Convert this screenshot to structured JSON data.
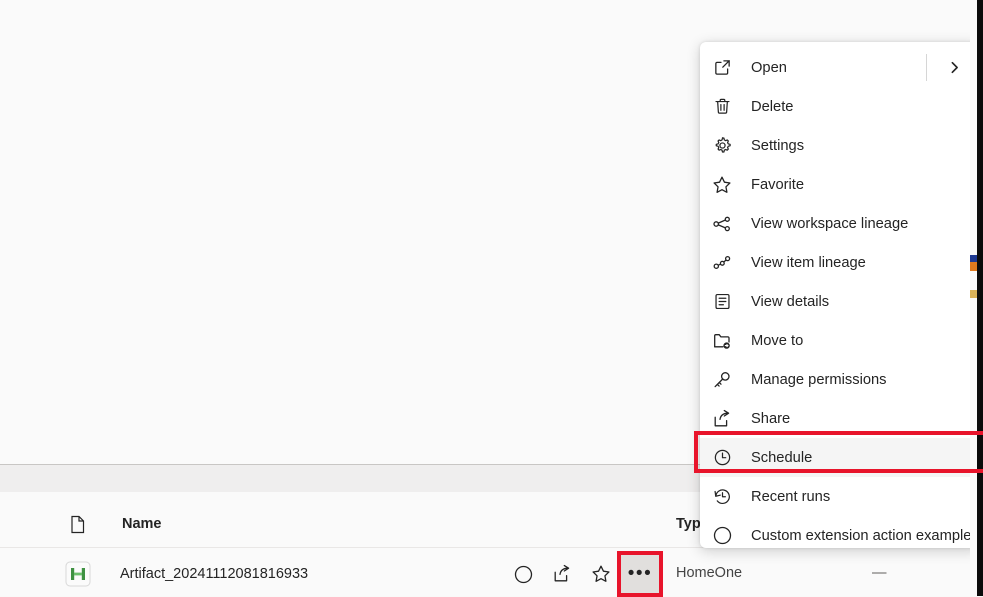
{
  "colors": {
    "highlight_red": "#e8142b",
    "menu_bg": "#ffffff",
    "selected_bg": "#f5f5f5",
    "page_bg": "#fafafa",
    "band_bg": "#efeeee",
    "text": "#242424",
    "artifact_icon_green": "#3a8f3a"
  },
  "table": {
    "columns": [
      {
        "key": "icon",
        "label": "",
        "icon": "document-icon"
      },
      {
        "key": "name",
        "label": "Name"
      },
      {
        "key": "type",
        "label": "Typ"
      }
    ],
    "rows": [
      {
        "icon": "artifact-green-icon",
        "name": "Artifact_20241112081816933",
        "workspace": "HomeOne",
        "refreshed": "—",
        "actions": [
          "circle-icon",
          "share-icon",
          "favorite-star-icon",
          "more-options-icon"
        ]
      }
    ]
  },
  "context_menu": {
    "items": [
      {
        "label": "Open",
        "icon": "open-external-icon",
        "has_submenu": true,
        "selected": false
      },
      {
        "label": "Delete",
        "icon": "trash-icon",
        "has_submenu": false,
        "selected": false
      },
      {
        "label": "Settings",
        "icon": "gear-icon",
        "has_submenu": false,
        "selected": false
      },
      {
        "label": "Favorite",
        "icon": "star-icon",
        "has_submenu": false,
        "selected": false
      },
      {
        "label": "View workspace lineage",
        "icon": "workspace-lineage-icon",
        "has_submenu": false,
        "selected": false
      },
      {
        "label": "View item lineage",
        "icon": "item-lineage-icon",
        "has_submenu": false,
        "selected": false
      },
      {
        "label": "View details",
        "icon": "details-icon",
        "has_submenu": false,
        "selected": false
      },
      {
        "label": "Move to",
        "icon": "move-to-folder-icon",
        "has_submenu": false,
        "selected": false
      },
      {
        "label": "Manage permissions",
        "icon": "key-icon",
        "has_submenu": false,
        "selected": false
      },
      {
        "label": "Share",
        "icon": "share-icon",
        "has_submenu": false,
        "selected": false
      },
      {
        "label": "Schedule",
        "icon": "clock-icon",
        "has_submenu": false,
        "selected": true
      },
      {
        "label": "Recent runs",
        "icon": "history-icon",
        "has_submenu": false,
        "selected": false
      },
      {
        "label": "Custom extension action example",
        "icon": "circle-icon",
        "has_submenu": false,
        "selected": false
      }
    ]
  },
  "annotations": {
    "schedule_highlight": "Schedule",
    "more_button_highlight": "more-options-icon"
  }
}
